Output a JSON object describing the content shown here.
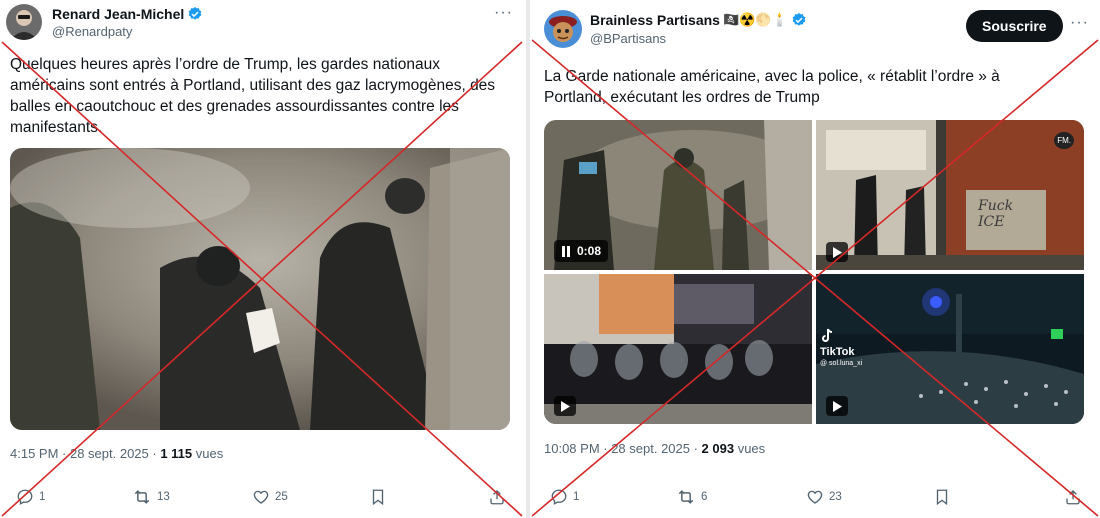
{
  "left_tweet": {
    "author_name": "Renard Jean-Michel",
    "handle": "@Renardpaty",
    "more": "···",
    "text": "Quelques heures après l’ordre de Trump, les gardes nationaux américains sont entrés à Portland, utilisant des gaz lacrymogènes, des balles en caoutchouc et des grenades assourdissantes contre les manifestants.",
    "time": "4:15 PM · 28 sept. 2025 · ",
    "views": "1 115",
    "views_label": " vues",
    "replies": "1",
    "retweets": "13",
    "likes": "25"
  },
  "right_tweet": {
    "author_name": "Brainless Partisans",
    "badges": "🏴‍☠️☢️🌕🕯️",
    "handle": "@BPartisans",
    "subscribe_label": "Souscrire",
    "more": "···",
    "text": "La Garde nationale américaine, avec la police, « rétablit l’ordre » à Portland, exécutant les ordres de Trump",
    "video_duration": "0:08",
    "tiktok_label": "TikTok",
    "tiktok_user": "@ sol.luna_xi",
    "watermark": "FM.",
    "graffiti": "Fuck ICE",
    "time": "10:08 PM · 28 sept. 2025 · ",
    "views": "2 093",
    "views_label": " vues",
    "replies": "1",
    "retweets": "6",
    "likes": "23"
  },
  "colors": {
    "cross": "#d62828",
    "verified": "#1d9bf0",
    "muted": "#536471"
  },
  "icons": [
    "verified-icon",
    "more-icon",
    "reply-icon",
    "retweet-icon",
    "like-icon",
    "bookmark-icon",
    "share-icon",
    "play-icon",
    "pause-icon",
    "tiktok-icon"
  ]
}
